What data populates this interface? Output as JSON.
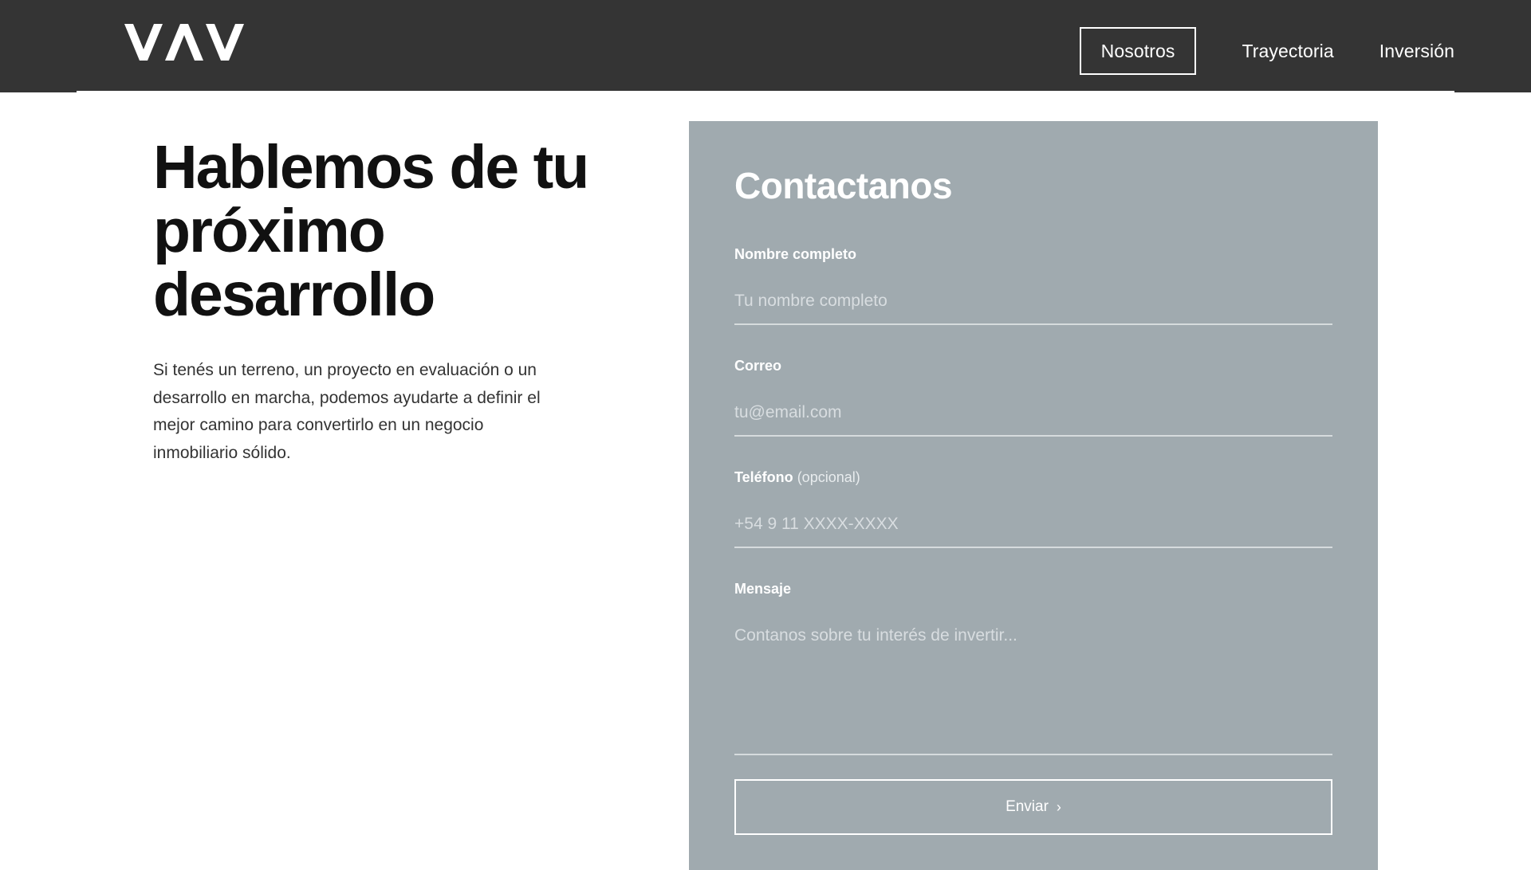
{
  "brand": {
    "logo_text": "VAV"
  },
  "nav": {
    "items": [
      {
        "label": "Nosotros",
        "active": true
      },
      {
        "label": "Trayectoria",
        "active": false
      },
      {
        "label": "Inversión",
        "active": false
      }
    ]
  },
  "hero": {
    "title_line1": "Hablemos de tu",
    "title_line2": "próximo",
    "title_line3": "desarrollo",
    "body": "Si tenés un terreno, un proyecto en evaluación o un desarrollo en marcha, podemos ayudarte a definir el mejor camino para convertirlo en un negocio inmobiliario sólido."
  },
  "form": {
    "title": "Contactanos",
    "name": {
      "label": "Nombre completo",
      "placeholder": "Tu nombre completo",
      "value": ""
    },
    "email": {
      "label": "Correo",
      "placeholder": "tu@email.com",
      "value": ""
    },
    "phone": {
      "label": "Teléfono",
      "optional_label": "(opcional)",
      "placeholder": "+54 9 11 XXXX-XXXX",
      "value": ""
    },
    "message": {
      "label": "Mensaje",
      "placeholder": "Contanos sobre tu interés de invertir...",
      "value": ""
    },
    "submit_label": "Enviar",
    "submit_icon": "chevron-right-icon"
  },
  "colors": {
    "header_bg": "#343434",
    "form_bg": "#a0aaaf",
    "text_dark": "#111111",
    "white": "#ffffff"
  }
}
